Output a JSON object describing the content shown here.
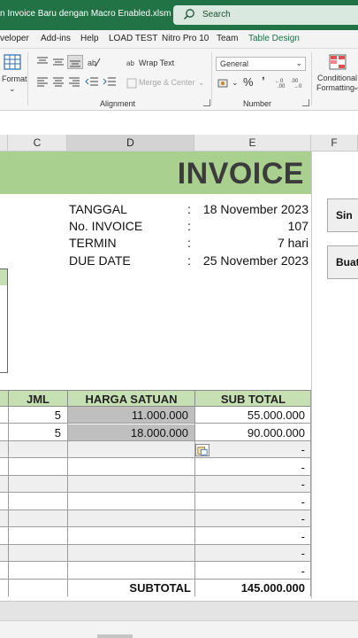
{
  "titlebar": {
    "doc_title": "n Invoice Baru dengan Macro Enabled.xlsm  -  E...",
    "search_placeholder": "Search",
    "accent": "#217346"
  },
  "ribbon_tabs": [
    {
      "label": "veloper"
    },
    {
      "label": "Add-ins"
    },
    {
      "label": "Help"
    },
    {
      "label": "LOAD TEST"
    },
    {
      "label": "Nitro Pro 10"
    },
    {
      "label": "Team"
    },
    {
      "label": "Table Design",
      "active": true
    }
  ],
  "ribbon": {
    "format_label": "Format",
    "wrap_text": "Wrap Text",
    "merge_center": "Merge & Center",
    "alignment_group": "Alignment",
    "number_format": "General",
    "number_group": "Number",
    "percent_symbol": "%",
    "comma_symbol": "ʼ",
    "conditional_formatting_line1": "Conditional",
    "conditional_formatting_line2": "Formatting"
  },
  "columns": [
    {
      "label": "C",
      "selected": false
    },
    {
      "label": "D",
      "selected": true
    },
    {
      "label": "E",
      "selected": false
    },
    {
      "label": "F",
      "selected": false
    }
  ],
  "invoice": {
    "title": "INVOICE",
    "info": [
      {
        "key": "TANGGAL",
        "sep": ":",
        "value": "18 November 2023"
      },
      {
        "key": "No. INVOICE",
        "sep": ":",
        "value": "107"
      },
      {
        "key": "TERMIN",
        "sep": ":",
        "value": "7 hari"
      },
      {
        "key": "DUE DATE",
        "sep": ":",
        "value": "25 November 2023"
      }
    ],
    "table_headers": {
      "jml": "JML",
      "harga": "HARGA SATUAN",
      "subtotal": "SUB TOTAL"
    },
    "rows": [
      {
        "jml": "5",
        "harga": "11.000.000",
        "subtotal": "55.000.000"
      },
      {
        "jml": "5",
        "harga": "18.000.000",
        "subtotal": "90.000.000"
      },
      {
        "jml": "",
        "harga": "",
        "subtotal": "-"
      },
      {
        "jml": "",
        "harga": "",
        "subtotal": "-"
      },
      {
        "jml": "",
        "harga": "",
        "subtotal": "-"
      },
      {
        "jml": "",
        "harga": "",
        "subtotal": "-"
      },
      {
        "jml": "",
        "harga": "",
        "subtotal": "-"
      },
      {
        "jml": "",
        "harga": "",
        "subtotal": "-"
      },
      {
        "jml": "",
        "harga": "",
        "subtotal": "-"
      },
      {
        "jml": "",
        "harga": "",
        "subtotal": "-"
      }
    ],
    "subtotal_label": "SUBTOTAL",
    "subtotal_value": "145.000.000",
    "banner_color": "#a9d08e",
    "header_color": "#c6e0b4"
  },
  "side_buttons": [
    {
      "label": "Sin"
    },
    {
      "label": "Buat"
    }
  ]
}
